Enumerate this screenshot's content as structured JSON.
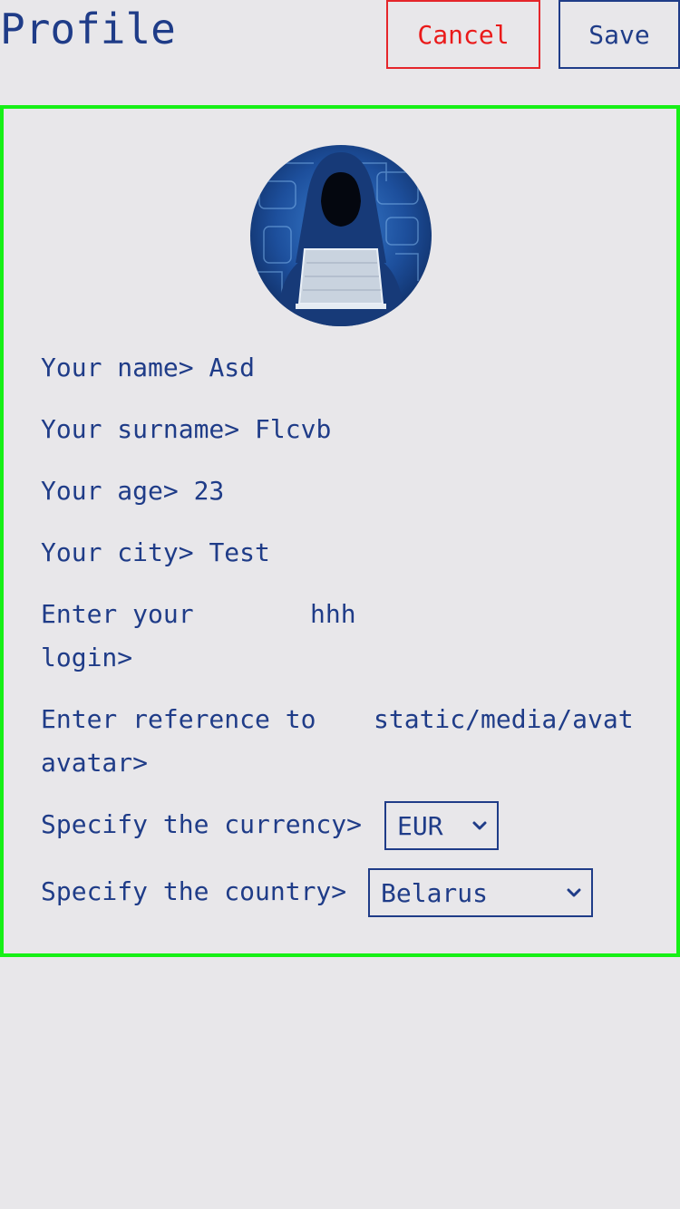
{
  "header": {
    "title": "Profile",
    "cancel_label": "Cancel",
    "save_label": "Save"
  },
  "colors": {
    "text": "#1f3c88",
    "background": "#e8e7ea",
    "cancel": "#ea1a1a",
    "panel_border": "#16f016"
  },
  "form": {
    "name": {
      "label": "Your name>",
      "value": "Asd"
    },
    "surname": {
      "label": "Your surname>",
      "value": "Flcvb"
    },
    "age": {
      "label": "Your age>",
      "value": "23"
    },
    "city": {
      "label": "Your city>",
      "value": "Test"
    },
    "login": {
      "label_line1": "Enter your",
      "label_line2": "login>",
      "value": "hhh"
    },
    "avatar_ref": {
      "label_line1": "Enter reference to",
      "label_line2": "avatar>",
      "value": "static/media/avat"
    },
    "currency": {
      "label": "Specify the currency>",
      "value": "EUR"
    },
    "country": {
      "label": "Specify the country>",
      "value": "Belarus"
    }
  },
  "icons": {
    "avatar": "hooded-hacker-avatar",
    "dropdown": "chevron-down-icon"
  }
}
